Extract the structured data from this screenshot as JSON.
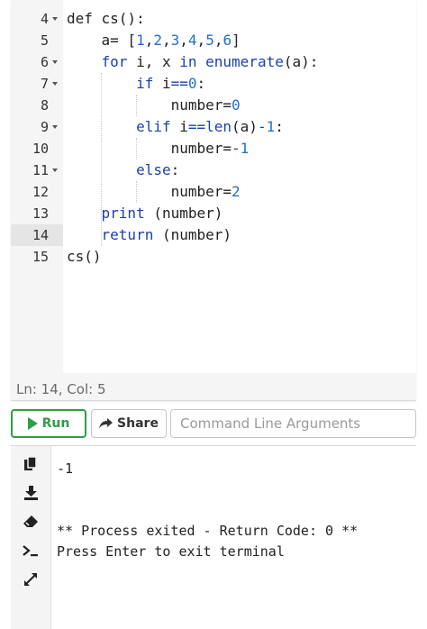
{
  "editor": {
    "lines": [
      {
        "n": "4",
        "fold": true,
        "code": "def cs():"
      },
      {
        "n": "5",
        "fold": false,
        "code": "    a= [1,2,3,4,5,6]"
      },
      {
        "n": "6",
        "fold": true,
        "code": "    for i, x in enumerate(a):"
      },
      {
        "n": "7",
        "fold": true,
        "code": "        if i==0:"
      },
      {
        "n": "8",
        "fold": false,
        "code": "            number=0"
      },
      {
        "n": "9",
        "fold": true,
        "code": "        elif i==len(a)-1:"
      },
      {
        "n": "10",
        "fold": false,
        "code": "            number=-1"
      },
      {
        "n": "11",
        "fold": true,
        "code": "        else:"
      },
      {
        "n": "12",
        "fold": false,
        "code": "            number=2"
      },
      {
        "n": "13",
        "fold": false,
        "code": "    print (number)"
      },
      {
        "n": "14",
        "fold": false,
        "code": "    return (number)"
      },
      {
        "n": "15",
        "fold": false,
        "code": "cs()"
      }
    ],
    "active_line": "14"
  },
  "status": {
    "text": "Ln: 14,  Col: 5"
  },
  "toolbar": {
    "run_label": "Run",
    "share_label": "Share",
    "cli_placeholder": "Command Line Arguments",
    "run_color": "#2e9e47"
  },
  "terminal": {
    "output": "-1\n\n\n** Process exited - Return Code: 0 **\nPress Enter to exit terminal",
    "tools": [
      "copy-icon",
      "download-icon",
      "eraser-icon",
      "terminal-prompt-icon",
      "expand-icon"
    ]
  }
}
